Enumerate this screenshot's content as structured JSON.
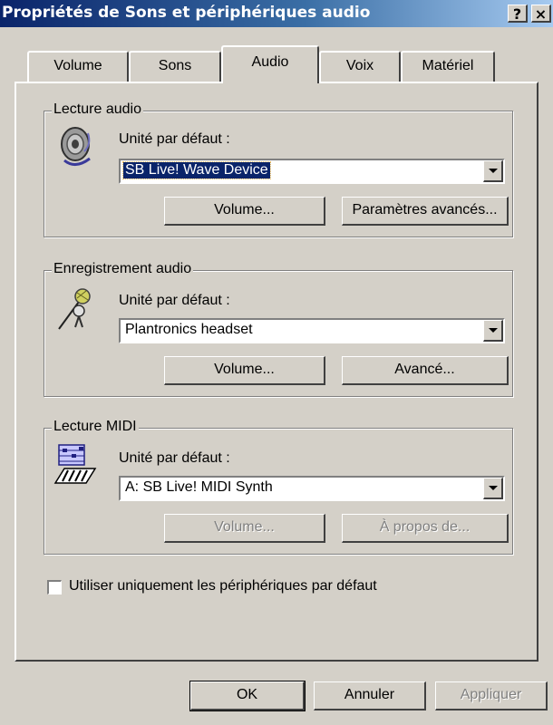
{
  "window": {
    "title": "Propriétés de Sons et périphériques audio",
    "help_button": "?",
    "close_button": "×"
  },
  "tabs": [
    {
      "label": "Volume"
    },
    {
      "label": "Sons"
    },
    {
      "label": "Audio"
    },
    {
      "label": "Voix"
    },
    {
      "label": "Matériel"
    }
  ],
  "active_tab": "Audio",
  "playback": {
    "group_label": "Lecture audio",
    "device_label": "Unité par défaut :",
    "device_value": "SB Live! Wave Device",
    "volume_button": "Volume...",
    "advanced_button": "Paramètres avancés..."
  },
  "recording": {
    "group_label": "Enregistrement audio",
    "device_label": "Unité par défaut :",
    "device_value": "Plantronics headset",
    "volume_button": "Volume...",
    "advanced_button": "Avancé..."
  },
  "midi": {
    "group_label": "Lecture MIDI",
    "device_label": "Unité par défaut :",
    "device_value": "A: SB Live! MIDI Synth",
    "volume_button": "Volume...",
    "about_button": "À propos de..."
  },
  "default_devices_checkbox": {
    "label": "Utiliser uniquement les périphériques par défaut",
    "checked": false
  },
  "footer": {
    "ok": "OK",
    "cancel": "Annuler",
    "apply": "Appliquer"
  },
  "colors": {
    "titlebar_start": "#0a246a",
    "titlebar_end": "#a6caf0",
    "face": "#d4d0c8",
    "selection": "#0a246a",
    "disabled_text": "#808080"
  }
}
